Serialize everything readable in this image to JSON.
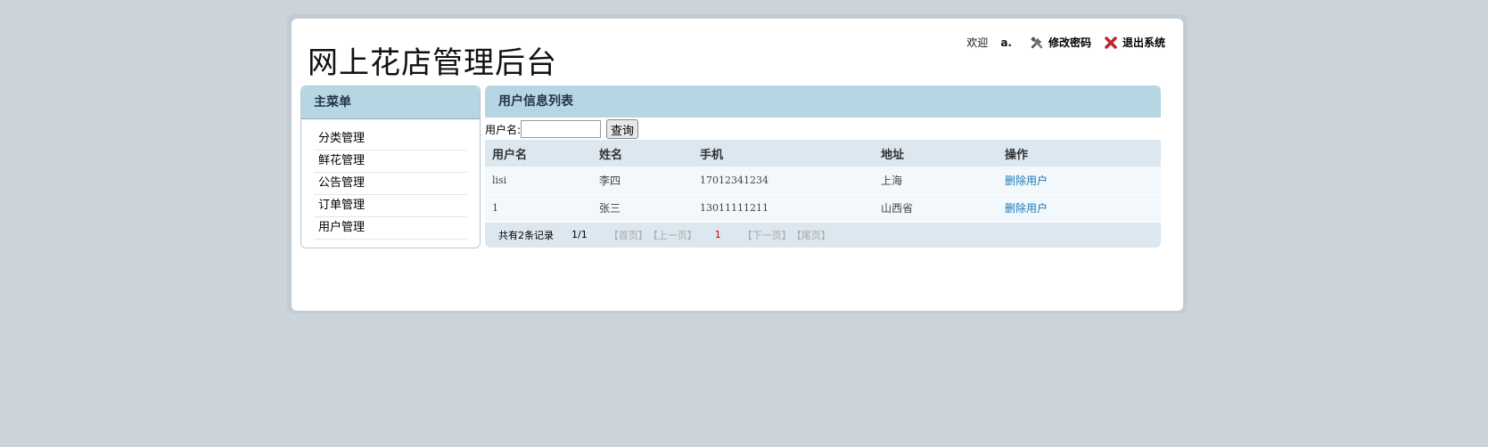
{
  "header": {
    "title": "网上花店管理后台",
    "welcome_label": "欢迎",
    "username": "a.",
    "change_password_label": "修改密码",
    "logout_label": "退出系统"
  },
  "sidebar": {
    "title": "主菜单",
    "items": [
      {
        "label": "分类管理"
      },
      {
        "label": "鲜花管理"
      },
      {
        "label": "公告管理"
      },
      {
        "label": "订单管理"
      },
      {
        "label": "用户管理"
      }
    ]
  },
  "main": {
    "title": "用户信息列表",
    "search": {
      "label": "用户名:",
      "value": "",
      "placeholder": "",
      "button_label": "查询"
    },
    "table": {
      "columns": [
        "用户名",
        "姓名",
        "手机",
        "地址",
        "操作"
      ],
      "rows": [
        {
          "username": "lisi",
          "name": "李四",
          "phone": "17012341234",
          "address": "上海",
          "action": "删除用户"
        },
        {
          "username": "1",
          "name": "张三",
          "phone": "13011111211",
          "address": "山西省",
          "action": "删除用户"
        }
      ]
    },
    "pager": {
      "total": "共有2条记录",
      "page_info": "1/1",
      "first_label": "【首页】",
      "prev_label": "【上一页】",
      "current": "1",
      "next_label": "【下一页】",
      "last_label": "【尾页】"
    }
  },
  "colors": {
    "background": "#cbd4db",
    "header_blue": "#b7d6e4",
    "table_head": "#dce7ef",
    "link": "#1a7ab8",
    "current_page": "#dd0000"
  }
}
